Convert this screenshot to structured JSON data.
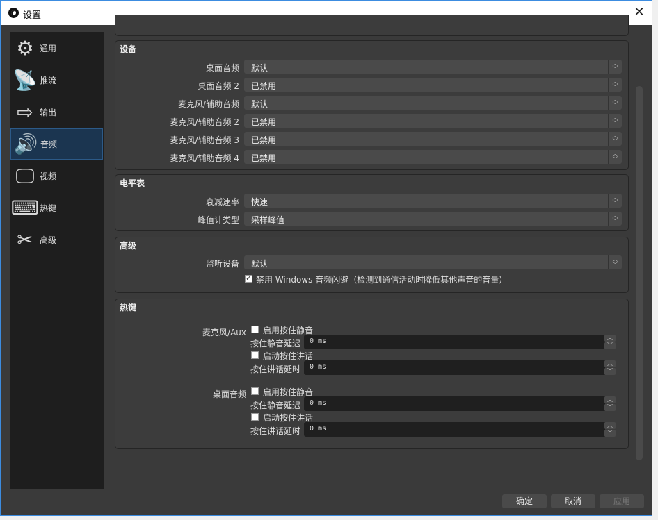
{
  "window": {
    "title": "设置",
    "close": "✕"
  },
  "sidebar": {
    "items": [
      {
        "label": "通用",
        "icon": "gear-icon",
        "glyph": "⚙"
      },
      {
        "label": "推流",
        "icon": "broadcast-icon",
        "glyph": "📡"
      },
      {
        "label": "输出",
        "icon": "output-icon",
        "glyph": "⇨"
      },
      {
        "label": "音频",
        "icon": "speaker-icon",
        "glyph": "🔊"
      },
      {
        "label": "视频",
        "icon": "monitor-icon",
        "glyph": "🖵"
      },
      {
        "label": "热键",
        "icon": "keyboard-icon",
        "glyph": "⌨"
      },
      {
        "label": "高级",
        "icon": "tools-icon",
        "glyph": "✂"
      }
    ],
    "selected": "音频"
  },
  "devices": {
    "title": "设备",
    "rows": [
      {
        "label": "桌面音频",
        "value": "默认"
      },
      {
        "label": "桌面音频 2",
        "value": "已禁用"
      },
      {
        "label": "麦克风/辅助音频",
        "value": "默认"
      },
      {
        "label": "麦克风/辅助音频 2",
        "value": "已禁用"
      },
      {
        "label": "麦克风/辅助音频 3",
        "value": "已禁用"
      },
      {
        "label": "麦克风/辅助音频 4",
        "value": "已禁用"
      }
    ]
  },
  "meters": {
    "title": "电平表",
    "rows": [
      {
        "label": "衰减速率",
        "value": "快速"
      },
      {
        "label": "峰值计类型",
        "value": "采样峰值"
      }
    ]
  },
  "advanced": {
    "title": "高级",
    "monitor_label": "监听设备",
    "monitor_value": "默认",
    "ducking_label": "禁用 Windows 音频闪避（检测到通信活动时降低其他声音的音量）",
    "ducking_checked": true
  },
  "hotkeys": {
    "title": "热键",
    "sources": [
      {
        "name": "麦克风/Aux",
        "mute_label": "启用按住静音",
        "mute_delay_label": "按住静音延迟",
        "mute_delay": "0  ms",
        "ptt_label": "启动按住讲话",
        "ptt_delay_label": "按住讲话延时",
        "ptt_delay": "0  ms"
      },
      {
        "name": "桌面音频",
        "mute_label": "启用按住静音",
        "mute_delay_label": "按住静音延迟",
        "mute_delay": "0  ms",
        "ptt_label": "启动按住讲话",
        "ptt_delay_label": "按住讲话延时",
        "ptt_delay": "0  ms"
      }
    ]
  },
  "buttons": {
    "ok": "确定",
    "cancel": "取消",
    "apply": "应用"
  },
  "glyphs": {
    "updown": "︿﹀",
    "up": "︿",
    "down": "﹀"
  }
}
